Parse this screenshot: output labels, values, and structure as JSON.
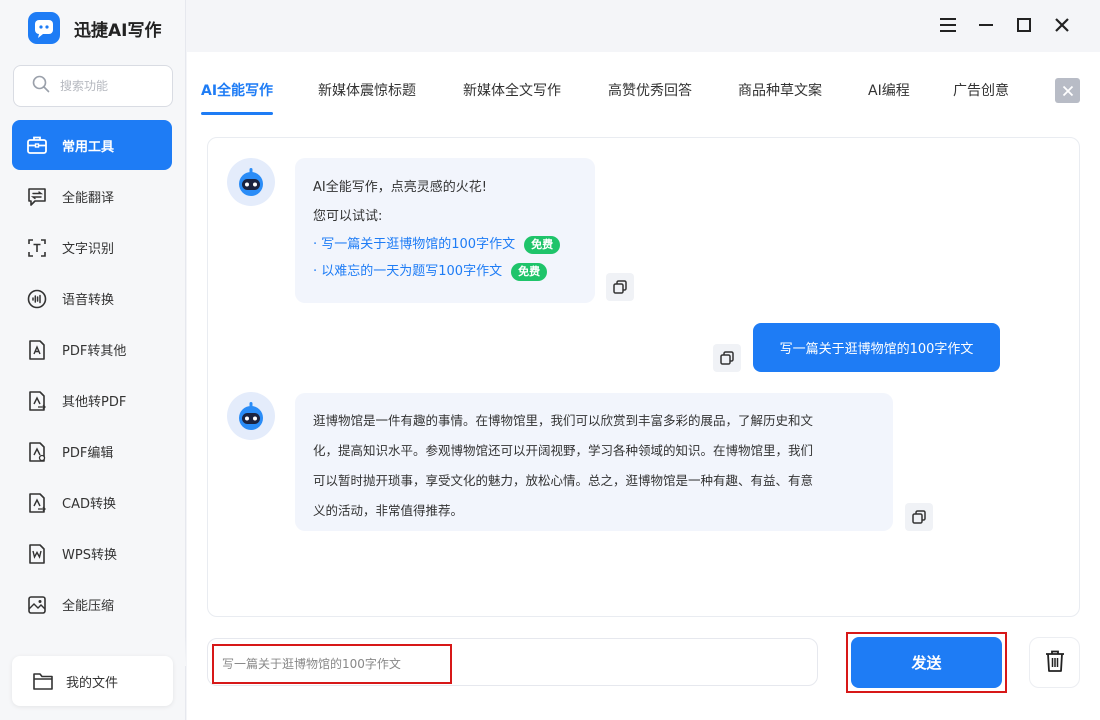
{
  "app": {
    "title": "迅捷AI写作"
  },
  "search": {
    "placeholder": "搜索功能"
  },
  "sidebar": {
    "items": [
      {
        "label": "常用工具",
        "icon": "toolbox-icon",
        "active": true
      },
      {
        "label": "全能翻译",
        "icon": "translate-icon"
      },
      {
        "label": "文字识别",
        "icon": "text-recognition-icon"
      },
      {
        "label": "语音转换",
        "icon": "voice-convert-icon"
      },
      {
        "label": "PDF转其他",
        "icon": "pdf-convert-icon"
      },
      {
        "label": "其他转PDF",
        "icon": "to-pdf-icon"
      },
      {
        "label": "PDF编辑",
        "icon": "pdf-edit-icon"
      },
      {
        "label": "CAD转换",
        "icon": "cad-convert-icon"
      },
      {
        "label": "WPS转换",
        "icon": "wps-convert-icon"
      },
      {
        "label": "全能压缩",
        "icon": "compress-icon"
      }
    ],
    "my_files": "我的文件"
  },
  "tabs": [
    "AI全能写作",
    "新媒体震惊标题",
    "新媒体全文写作",
    "高赞优秀回答",
    "商品种草文案",
    "AI编程",
    "广告创意"
  ],
  "chat": {
    "welcome": {
      "greeting": "AI全能写作，点亮灵感的火花!",
      "try_label": "您可以试试:",
      "suggestions": [
        {
          "text": "· 写一篇关于逛博物馆的100字作文",
          "badge": "免费"
        },
        {
          "text": "· 以难忘的一天为题写100字作文",
          "badge": "免费"
        }
      ]
    },
    "user_message": "写一篇关于逛博物馆的100字作文",
    "reply_lines": [
      "逛博物馆是一件有趣的事情。在博物馆里，我们可以欣赏到丰富多彩的展品，了解历史和文",
      "化，提高知识水平。参观博物馆还可以开阔视野，学习各种领域的知识。在博物馆里，我们",
      "可以暂时抛开琐事，享受文化的魅力，放松心情。总之，逛博物馆是一种有趣、有益、有意",
      "义的活动，非常值得推荐。"
    ]
  },
  "input": {
    "value": "写一篇关于逛博物馆的100字作文"
  },
  "send_label": "发送",
  "colors": {
    "accent": "#1e7cf5",
    "badge": "#1fc46a",
    "highlight": "#d71818"
  }
}
